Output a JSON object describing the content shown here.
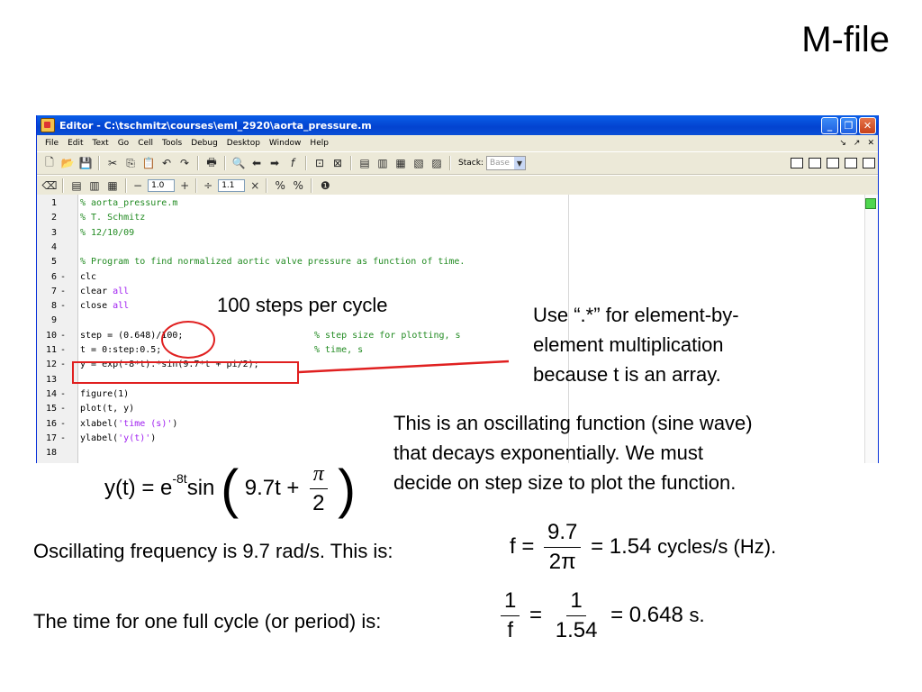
{
  "slide": {
    "title": "M-file"
  },
  "editor": {
    "window_title": "Editor - C:\\tschmitz\\courses\\eml_2920\\aorta_pressure.m",
    "menu": [
      "File",
      "Edit",
      "Text",
      "Go",
      "Cell",
      "Tools",
      "Debug",
      "Desktop",
      "Window",
      "Help"
    ],
    "stack_label": "Stack:",
    "stack_value": "Base",
    "cell_field_1": "1.0",
    "cell_field_2": "1.1",
    "lines": [
      {
        "n": "1",
        "dash": "",
        "parts": [
          {
            "t": "% aorta_pressure.m",
            "c": "cmt"
          }
        ]
      },
      {
        "n": "2",
        "dash": "",
        "parts": [
          {
            "t": "% T. Schmitz",
            "c": "cmt"
          }
        ]
      },
      {
        "n": "3",
        "dash": "",
        "parts": [
          {
            "t": "% 12/10/09",
            "c": "cmt"
          }
        ]
      },
      {
        "n": "4",
        "dash": "",
        "parts": []
      },
      {
        "n": "5",
        "dash": "",
        "parts": [
          {
            "t": "% Program to find normalized aortic valve pressure as function of time.",
            "c": "cmt"
          }
        ]
      },
      {
        "n": "6",
        "dash": "-",
        "parts": [
          {
            "t": "clc",
            "c": ""
          }
        ]
      },
      {
        "n": "7",
        "dash": "-",
        "parts": [
          {
            "t": "clear ",
            "c": ""
          },
          {
            "t": "all",
            "c": "kw"
          }
        ]
      },
      {
        "n": "8",
        "dash": "-",
        "parts": [
          {
            "t": "close ",
            "c": ""
          },
          {
            "t": "all",
            "c": "kw"
          }
        ]
      },
      {
        "n": "9",
        "dash": "",
        "parts": []
      },
      {
        "n": "10",
        "dash": "-",
        "parts": [
          {
            "t": "step = (0.648)/100;",
            "c": ""
          }
        ],
        "comment": "% step size for plotting, s"
      },
      {
        "n": "11",
        "dash": "-",
        "parts": [
          {
            "t": "t = 0:step:0.5;",
            "c": ""
          }
        ],
        "comment": "% time, s"
      },
      {
        "n": "12",
        "dash": "-",
        "parts": [
          {
            "t": "y = exp(-8*t).*sin(9.7*t + pi/2);",
            "c": ""
          }
        ]
      },
      {
        "n": "13",
        "dash": "",
        "parts": []
      },
      {
        "n": "14",
        "dash": "-",
        "parts": [
          {
            "t": "figure(1)",
            "c": ""
          }
        ]
      },
      {
        "n": "15",
        "dash": "-",
        "parts": [
          {
            "t": "plot(t, y)",
            "c": ""
          }
        ]
      },
      {
        "n": "16",
        "dash": "-",
        "parts": [
          {
            "t": "xlabel(",
            "c": ""
          },
          {
            "t": "'time (s)'",
            "c": "str"
          },
          {
            "t": ")",
            "c": ""
          }
        ]
      },
      {
        "n": "17",
        "dash": "-",
        "parts": [
          {
            "t": "ylabel(",
            "c": ""
          },
          {
            "t": "'y(t)'",
            "c": "str"
          },
          {
            "t": ")",
            "c": ""
          }
        ]
      },
      {
        "n": "18",
        "dash": "",
        "parts": []
      }
    ]
  },
  "annotations": {
    "steps": "100 steps per cycle",
    "elementwise": [
      "Use “.*” for element-by-",
      "element multiplication",
      "because t is an array."
    ],
    "oscillating": [
      "This is an oscillating function (sine wave)",
      "that decays exponentially. We must",
      "decide on step size to plot the function."
    ],
    "freq_text": "Oscillating frequency is 9.7 rad/s. This is:",
    "period_text": "The time for one full cycle (or period) is:"
  },
  "equations": {
    "y_lhs": "y(t) = e",
    "y_exp": "-8t",
    "y_sin": "sin",
    "y_arg": "9.7t +",
    "pi": "π",
    "two": "2",
    "f_lhs": "f =",
    "f_num": "9.7",
    "f_den": "2π",
    "f_val": "= 1.54",
    "f_unit": "cycles/s (Hz).",
    "p_num1": "1",
    "p_den1": "f",
    "p_eq": "=",
    "p_num2": "1",
    "p_den2": "1.54",
    "p_val": "= 0.648",
    "p_unit": "s."
  },
  "colors": {
    "annotation_red": "#e02020",
    "comment_green": "#228b22",
    "keyword_purple": "#a020f0"
  }
}
